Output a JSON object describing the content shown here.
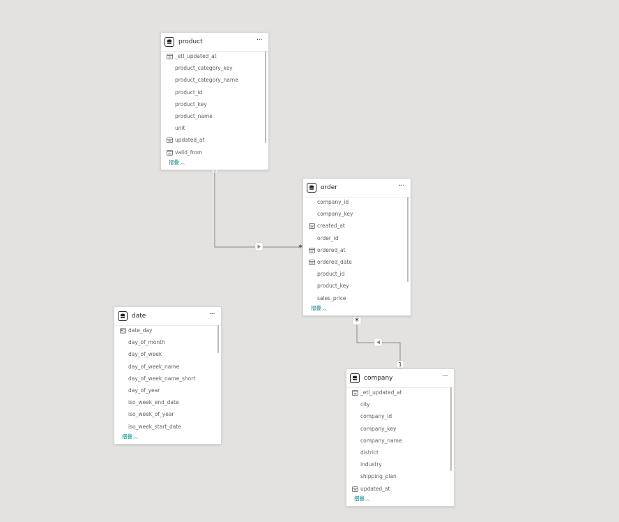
{
  "tables": {
    "product": {
      "title": "product",
      "more_label": "···",
      "collapse_label": "摺疊",
      "fields": [
        {
          "name": "_etl_updated_at",
          "icon": "datetime-icon"
        },
        {
          "name": "product_category_key",
          "icon": ""
        },
        {
          "name": "product_category_name",
          "icon": ""
        },
        {
          "name": "product_id",
          "icon": ""
        },
        {
          "name": "product_key",
          "icon": ""
        },
        {
          "name": "product_name",
          "icon": ""
        },
        {
          "name": "unit",
          "icon": ""
        },
        {
          "name": "updated_at",
          "icon": "datetime-icon"
        },
        {
          "name": "valid_from",
          "icon": "datetime-icon"
        }
      ]
    },
    "order": {
      "title": "order",
      "more_label": "···",
      "collapse_label": "摺疊",
      "fields": [
        {
          "name": "company_id",
          "icon": ""
        },
        {
          "name": "company_key",
          "icon": ""
        },
        {
          "name": "created_at",
          "icon": "datetime-icon"
        },
        {
          "name": "order_id",
          "icon": ""
        },
        {
          "name": "ordered_at",
          "icon": "datetime-icon"
        },
        {
          "name": "ordered_date",
          "icon": "datetime-icon"
        },
        {
          "name": "product_id",
          "icon": ""
        },
        {
          "name": "product_key",
          "icon": ""
        },
        {
          "name": "sales_price",
          "icon": ""
        }
      ]
    },
    "date": {
      "title": "date",
      "more_label": "···",
      "collapse_label": "摺疊",
      "fields": [
        {
          "name": "date_day",
          "icon": "id-card-icon"
        },
        {
          "name": "day_of_month",
          "icon": ""
        },
        {
          "name": "day_of_week",
          "icon": ""
        },
        {
          "name": "day_of_week_name",
          "icon": ""
        },
        {
          "name": "day_of_week_name_short",
          "icon": ""
        },
        {
          "name": "day_of_year",
          "icon": ""
        },
        {
          "name": "iso_week_end_date",
          "icon": ""
        },
        {
          "name": "iso_week_of_year",
          "icon": ""
        },
        {
          "name": "iso_week_start_date",
          "icon": ""
        }
      ]
    },
    "company": {
      "title": "company",
      "more_label": "···",
      "collapse_label": "摺疊",
      "fields": [
        {
          "name": "_etl_updated_at",
          "icon": "datetime-icon"
        },
        {
          "name": "city",
          "icon": ""
        },
        {
          "name": "company_id",
          "icon": ""
        },
        {
          "name": "company_key",
          "icon": ""
        },
        {
          "name": "company_name",
          "icon": ""
        },
        {
          "name": "district",
          "icon": ""
        },
        {
          "name": "industry",
          "icon": ""
        },
        {
          "name": "shipping_plan",
          "icon": ""
        },
        {
          "name": "updated_at",
          "icon": "datetime-icon"
        }
      ]
    }
  },
  "relationships": [
    {
      "from": "product",
      "to": "order",
      "from_cardinality": "1",
      "to_cardinality": "*"
    },
    {
      "from": "company",
      "to": "order",
      "from_cardinality": "1",
      "to_cardinality": "*"
    }
  ],
  "colors": {
    "canvas": "#e3e2e0",
    "accent": "#118d85",
    "line": "#8a8886"
  }
}
